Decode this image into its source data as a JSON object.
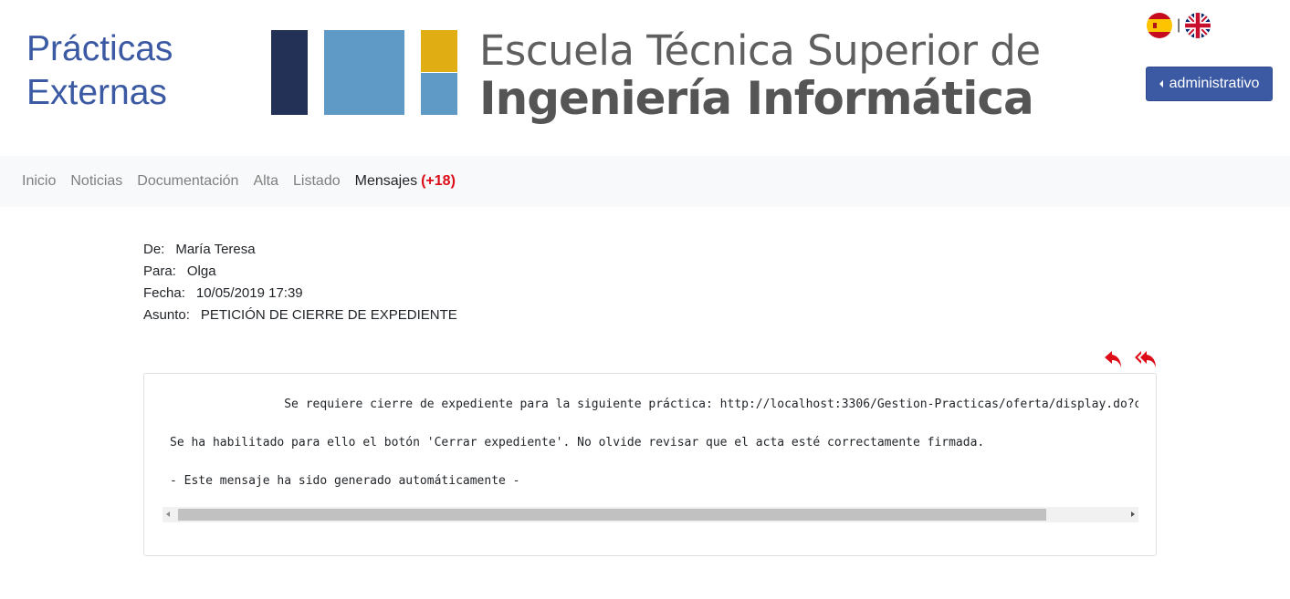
{
  "header": {
    "site_title_line1": "Prácticas",
    "site_title_line2": "Externas",
    "logo_line1": "Escuela Técnica Superior de",
    "logo_line2": "Ingeniería Informática",
    "role_button_label": "administrativo",
    "language_separator": "|",
    "languages": [
      "spanish-flag-icon",
      "uk-flag-icon"
    ]
  },
  "nav": {
    "items": [
      "Inicio",
      "Noticias",
      "Documentación",
      "Alta",
      "Listado"
    ],
    "messages_label": "Mensajes",
    "messages_count": "(+18)"
  },
  "message": {
    "from_label": "De:",
    "from_value": "María Teresa",
    "to_label": "Para:",
    "to_value": "Olga",
    "date_label": "Fecha:",
    "date_value": "10/05/2019 17:39",
    "subject_label": "Asunto:",
    "subject_value": "PETICIÓN DE CIERRE DE EXPEDIENTE",
    "body_line1": "\t\tSe requiere cierre de expediente para la siguiente práctica: http://localhost:3306/Gestion-Practicas/oferta/display.do?ofertaId=",
    "body_line2": "Se ha habilitado para ello el botón 'Cerrar expediente'. No olvide revisar que el acta esté correctamente firmada.",
    "body_line3": "- Este mensaje ha sido generado automáticamente -"
  },
  "actions": {
    "reply_icon": "reply-icon",
    "reply_all_icon": "reply-all-icon"
  },
  "colors": {
    "brand_blue": "#3b5aa3",
    "logo_navy": "#223155",
    "logo_light_blue": "#5f9ac6",
    "logo_gold": "#e0ad12",
    "alert_red": "#dc0c18",
    "navbar_bg": "#f8f9fa"
  }
}
